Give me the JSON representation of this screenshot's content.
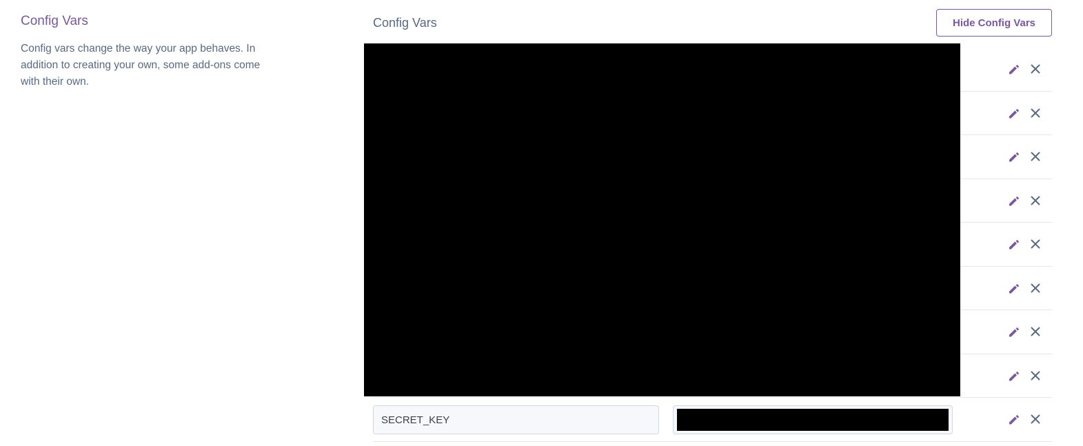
{
  "section": {
    "heading": "Config Vars",
    "description": "Config vars change the way your app behaves. In addition to creating your own, some add-ons come with their own."
  },
  "panel": {
    "title": "Config Vars",
    "hide_button_label": "Hide Config Vars"
  },
  "config_vars": [
    {
      "key": "",
      "value": "",
      "redacted": true
    },
    {
      "key": "",
      "value": "",
      "redacted": true
    },
    {
      "key": "",
      "value": "",
      "redacted": true
    },
    {
      "key": "",
      "value": "",
      "redacted": true
    },
    {
      "key": "",
      "value": "",
      "redacted": true
    },
    {
      "key": "",
      "value": "",
      "redacted": true
    },
    {
      "key": "",
      "value": "",
      "redacted": true
    },
    {
      "key": "",
      "value": "",
      "redacted": true
    },
    {
      "key": "SECRET_KEY",
      "value": "",
      "redacted_value": true
    }
  ],
  "icons": {
    "edit": "pencil-icon",
    "delete": "close-icon"
  },
  "colors": {
    "accent": "#79589f",
    "muted_text": "#596981",
    "icon_gray": "#596981",
    "divider": "#e3e7ec"
  }
}
